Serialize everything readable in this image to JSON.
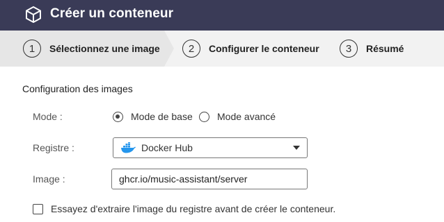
{
  "window": {
    "title": "Créer un conteneur"
  },
  "steps": [
    {
      "number": "1",
      "label": "Sélectionnez une image",
      "active": true
    },
    {
      "number": "2",
      "label": "Configurer le conteneur",
      "active": false
    },
    {
      "number": "3",
      "label": "Résumé",
      "active": false
    }
  ],
  "form": {
    "section_title": "Configuration des images",
    "mode": {
      "label": "Mode :",
      "options": [
        {
          "label": "Mode de base",
          "checked": true
        },
        {
          "label": "Mode avancé",
          "checked": false
        }
      ]
    },
    "registry": {
      "label": "Registre :",
      "selected": "Docker Hub",
      "icon": "docker-whale-icon"
    },
    "image": {
      "label": "Image :",
      "value": "ghcr.io/music-assistant/server"
    },
    "pull_checkbox": {
      "label": "Essayez d'extraire l'image du registre avant de créer le conteneur.",
      "checked": false
    }
  },
  "colors": {
    "titlebar": "#3a3b57",
    "active_step": "#ebebeb",
    "docker_blue": "#2496ed"
  }
}
